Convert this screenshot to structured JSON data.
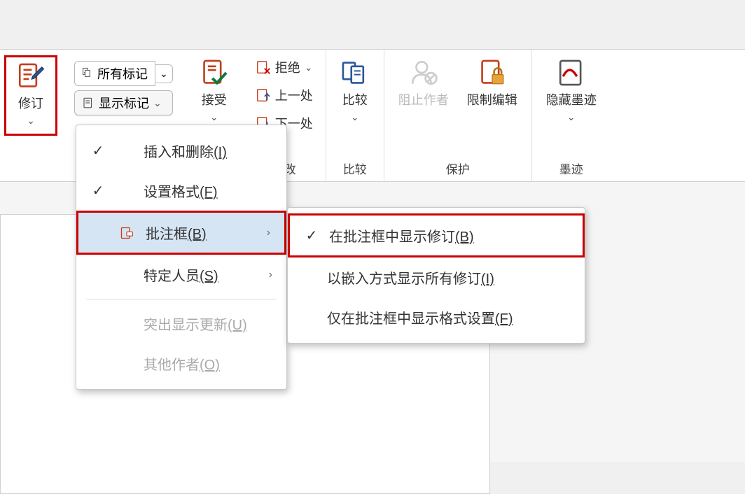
{
  "ribbon": {
    "track_changes": {
      "label": "修订"
    },
    "tracking": {
      "all_markup": "所有标记",
      "show_markup": "显示标记"
    },
    "accept": {
      "label": "接受"
    },
    "reject": {
      "label": "拒绝"
    },
    "previous": {
      "label": "上一处"
    },
    "next": {
      "label": "下一处"
    },
    "changes_group": "更改",
    "compare": {
      "label": "比较"
    },
    "compare_group": "比较",
    "block_authors": {
      "label": "阻止作者"
    },
    "restrict_editing": {
      "label": "限制编辑"
    },
    "protect_group": "保护",
    "hide_ink": {
      "label": "隐藏墨迹"
    },
    "ink_group": "墨迹"
  },
  "menu1": {
    "insertions_deletions": "插入和删除",
    "formatting": "设置格式",
    "balloons": "批注框",
    "specific_people": "特定人员",
    "highlight_updates": "突出显示更新",
    "other_authors": "其他作者",
    "shortcut_i": "(I)",
    "shortcut_f": "(F)",
    "shortcut_b": "(B)",
    "shortcut_s": "(S)",
    "shortcut_u": "(U)",
    "shortcut_o": "(O)"
  },
  "menu2": {
    "show_revisions_in_balloons": "在批注框中显示修订",
    "show_all_inline": "以嵌入方式显示所有修订",
    "show_only_formatting": "仅在批注框中显示格式设置",
    "shortcut_b": "(B)",
    "shortcut_i": "(I)",
    "shortcut_f": "(F)"
  }
}
